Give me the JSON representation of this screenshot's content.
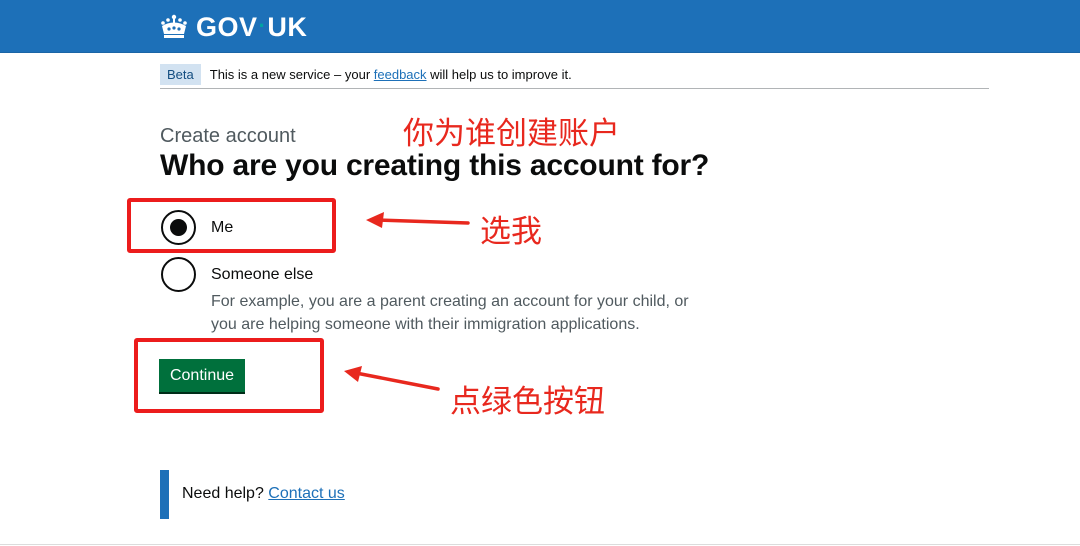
{
  "header": {
    "logo_text_left": "GOV",
    "logo_separator": "·",
    "logo_text_right": "UK",
    "crown_icon": "crown-icon"
  },
  "phase_banner": {
    "tag": "Beta",
    "text_before": "This is a new service – your ",
    "link": "feedback",
    "text_after": " will help us to improve it."
  },
  "form": {
    "caption": "Create account",
    "heading": "Who are you creating this account for?",
    "options": [
      {
        "label": "Me",
        "checked": true
      },
      {
        "label": "Someone else",
        "checked": false
      }
    ],
    "hint_line1": "For example, you are a parent creating an account for your child, or",
    "hint_line2": "you are helping someone with their immigration applications.",
    "continue_button": "Continue"
  },
  "help": {
    "text": "Need help? ",
    "link": "Contact us"
  },
  "annotations": {
    "title_note": "你为谁创建账户",
    "radio_note": "选我",
    "button_note": "点绿色按钮",
    "color": "#e8281e"
  },
  "colors": {
    "header_blue": "#1d70b8",
    "button_green": "#00703c",
    "annotation_red": "#e8281e"
  }
}
